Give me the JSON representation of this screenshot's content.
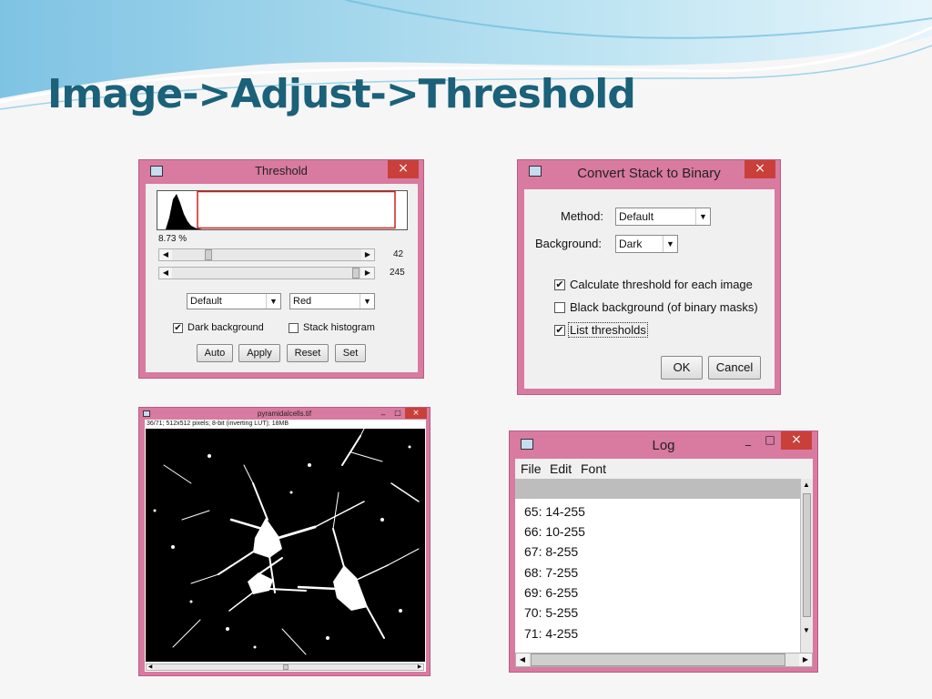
{
  "slide": {
    "title": "Image->Adjust->Threshold"
  },
  "threshold_window": {
    "title": "Threshold",
    "close_label": "×",
    "percent": "8.73 %",
    "slider1_value": "42",
    "slider2_value": "245",
    "method_select": "Default",
    "mode_select": "Red",
    "dark_background_label": "Dark background",
    "dark_background_checked": true,
    "stack_histogram_label": "Stack histogram",
    "stack_histogram_checked": false,
    "buttons": {
      "auto": "Auto",
      "apply": "Apply",
      "reset": "Reset",
      "set": "Set"
    }
  },
  "convert_window": {
    "title": "Convert Stack to Binary",
    "close_label": "×",
    "method_label": "Method:",
    "method_value": "Default",
    "background_label": "Background:",
    "background_value": "Dark",
    "calc_threshold_label": "Calculate threshold for each image",
    "black_background_label": "Black background (of binary masks)",
    "list_thresholds_label": "List thresholds",
    "ok_label": "OK",
    "cancel_label": "Cancel"
  },
  "image_window": {
    "title": "pyramidalcells.tif",
    "info": "36/71; 512x512 pixels; 8-bit (inverting LUT); 18MB"
  },
  "log_window": {
    "title": "Log",
    "menu": [
      "File",
      "Edit",
      "Font"
    ],
    "lines": [
      "65: 14-255",
      "66: 10-255",
      "67: 8-255",
      "68: 7-255",
      "69: 6-255",
      "70: 5-255",
      "71: 4-255"
    ]
  },
  "icon_names": [
    "imagej-window-icon",
    "close-icon",
    "dropdown-arrow-icon",
    "checkbox-icon",
    "scroll-arrow-icon"
  ]
}
